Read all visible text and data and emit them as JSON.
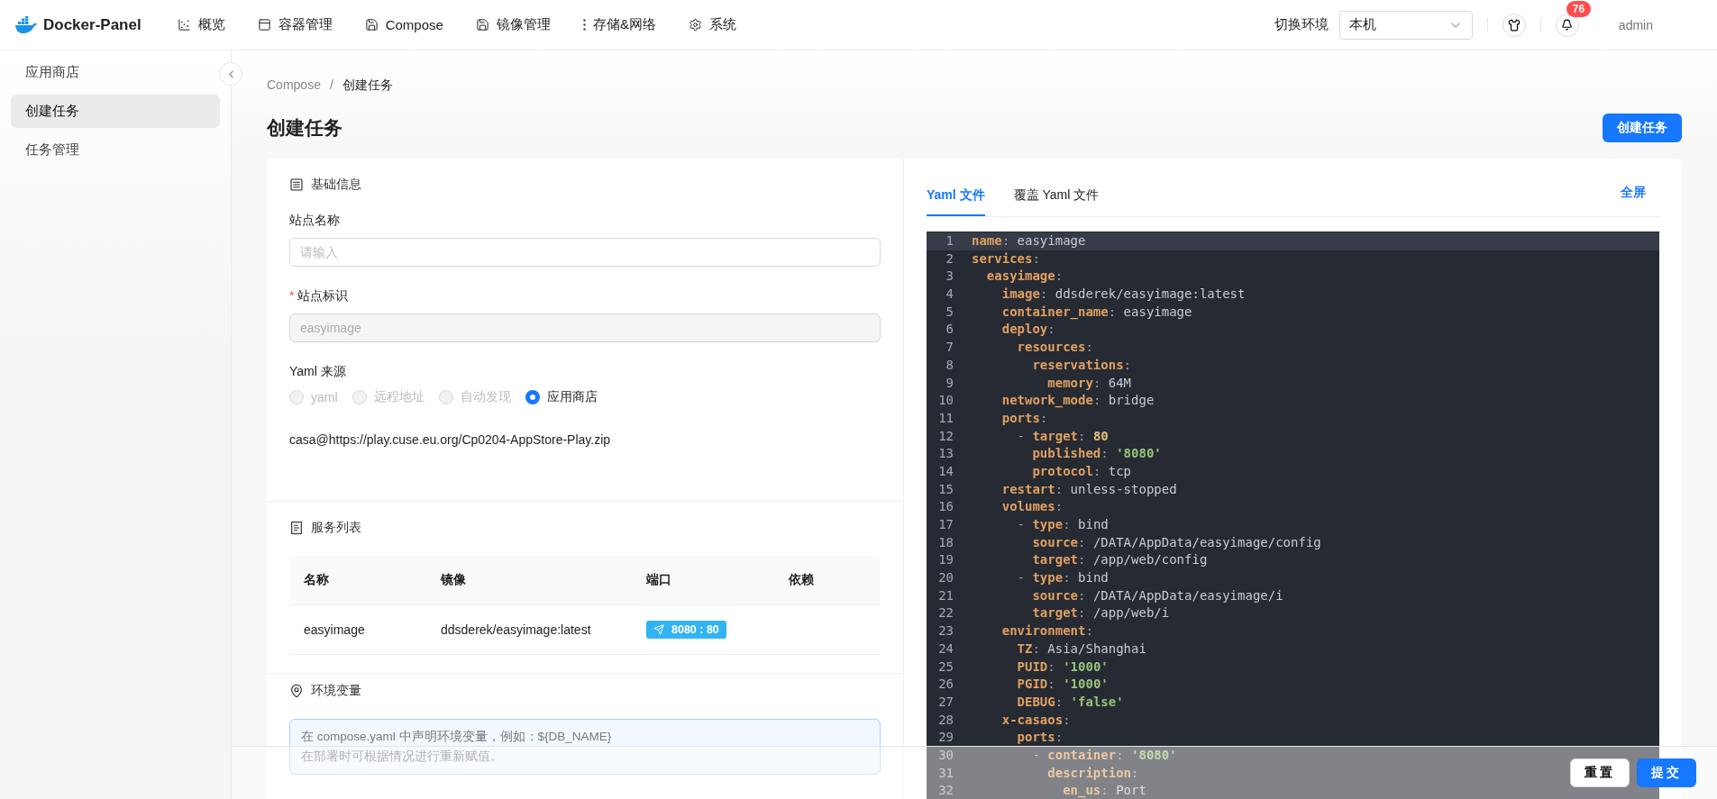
{
  "header": {
    "brand": "Docker-Panel",
    "nav": [
      {
        "label": "概览"
      },
      {
        "label": "容器管理"
      },
      {
        "label": "Compose"
      },
      {
        "label": "镜像管理"
      },
      {
        "label": "存储&网络"
      },
      {
        "label": "系统"
      }
    ],
    "env_label": "切换环境",
    "env_value": "本机",
    "notification_count": "76",
    "user": "admin"
  },
  "sidebar": {
    "items": [
      {
        "label": "应用商店",
        "selected": false
      },
      {
        "label": "创建任务",
        "selected": true
      },
      {
        "label": "任务管理",
        "selected": false
      }
    ]
  },
  "breadcrumb": [
    "Compose",
    "创建任务"
  ],
  "breadcrumb_separator": "/",
  "title": "创建任务",
  "create_button": "创建任务",
  "basic": {
    "title": "基础信息",
    "site_name": {
      "label": "站点名称",
      "placeholder": "请输入"
    },
    "site_id": {
      "label": "站点标识",
      "required_mark": "*",
      "value": "easyimage",
      "disabled": true
    },
    "source": {
      "label": "Yaml 来源",
      "options": [
        {
          "label": "yaml",
          "selected": false,
          "disabled": true
        },
        {
          "label": "远程地址",
          "selected": false,
          "disabled": true
        },
        {
          "label": "自动发现",
          "selected": false,
          "disabled": true
        },
        {
          "label": "应用商店",
          "selected": true,
          "disabled": false
        }
      ],
      "value": "casa@https://play.cuse.eu.org/Cp0204-AppStore-Play.zip"
    }
  },
  "services": {
    "title": "服务列表",
    "columns": [
      "名称",
      "镜像",
      "端口",
      "依赖"
    ],
    "rows": [
      {
        "name": "easyimage",
        "image": "ddsderek/easyimage:latest",
        "ports": [
          "8080 : 80"
        ]
      }
    ]
  },
  "env": {
    "title": "环境变量",
    "hint": [
      "在 compose.yaml 中声明环境变量，例如：${DB_NAME}",
      "在部署时可根据情况进行重新赋值。"
    ]
  },
  "editor": {
    "tabs": [
      {
        "label": "Yaml 文件",
        "selected": true
      },
      {
        "label": "覆盖 Yaml 文件",
        "selected": false
      }
    ],
    "fullscreen": "全屏",
    "lines": [
      {
        "n": "1",
        "text": "name: easyimage",
        "active": true
      },
      {
        "n": "2",
        "text": "services:",
        "active": false
      },
      {
        "n": "3",
        "text": "  easyimage:",
        "active": false
      },
      {
        "n": "4",
        "text": "    image: ddsderek/easyimage:latest",
        "active": false
      },
      {
        "n": "5",
        "text": "    container_name: easyimage",
        "active": false
      },
      {
        "n": "6",
        "text": "    deploy:",
        "active": false
      },
      {
        "n": "7",
        "text": "      resources:",
        "active": false
      },
      {
        "n": "8",
        "text": "        reservations:",
        "active": false
      },
      {
        "n": "9",
        "text": "          memory: 64M",
        "active": false
      },
      {
        "n": "10",
        "text": "    network_mode: bridge",
        "active": false
      },
      {
        "n": "11",
        "text": "    ports:",
        "active": false
      },
      {
        "n": "12",
        "text": "      - target: 80",
        "active": false
      },
      {
        "n": "13",
        "text": "        published: '8080'",
        "active": false
      },
      {
        "n": "14",
        "text": "        protocol: tcp",
        "active": false
      },
      {
        "n": "15",
        "text": "    restart: unless-stopped",
        "active": false
      },
      {
        "n": "16",
        "text": "    volumes:",
        "active": false
      },
      {
        "n": "17",
        "text": "      - type: bind",
        "active": false
      },
      {
        "n": "18",
        "text": "        source: /DATA/AppData/easyimage/config",
        "active": false
      },
      {
        "n": "19",
        "text": "        target: /app/web/config",
        "active": false
      },
      {
        "n": "20",
        "text": "      - type: bind",
        "active": false
      },
      {
        "n": "21",
        "text": "        source: /DATA/AppData/easyimage/i",
        "active": false
      },
      {
        "n": "22",
        "text": "        target: /app/web/i",
        "active": false
      },
      {
        "n": "23",
        "text": "    environment:",
        "active": false
      },
      {
        "n": "24",
        "text": "      TZ: Asia/Shanghai",
        "active": false
      },
      {
        "n": "25",
        "text": "      PUID: '1000'",
        "active": false
      },
      {
        "n": "26",
        "text": "      PGID: '1000'",
        "active": false
      },
      {
        "n": "27",
        "text": "      DEBUG: 'false'",
        "active": false
      },
      {
        "n": "28",
        "text": "    x-casaos:",
        "active": false
      },
      {
        "n": "29",
        "text": "      ports:",
        "active": false
      },
      {
        "n": "30",
        "text": "        - container: '8080'",
        "active": false
      },
      {
        "n": "31",
        "text": "          description:",
        "active": false
      },
      {
        "n": "32",
        "text": "            en_us: Port",
        "active": false
      }
    ]
  },
  "footer": {
    "reset": "重置",
    "submit": "提交"
  }
}
